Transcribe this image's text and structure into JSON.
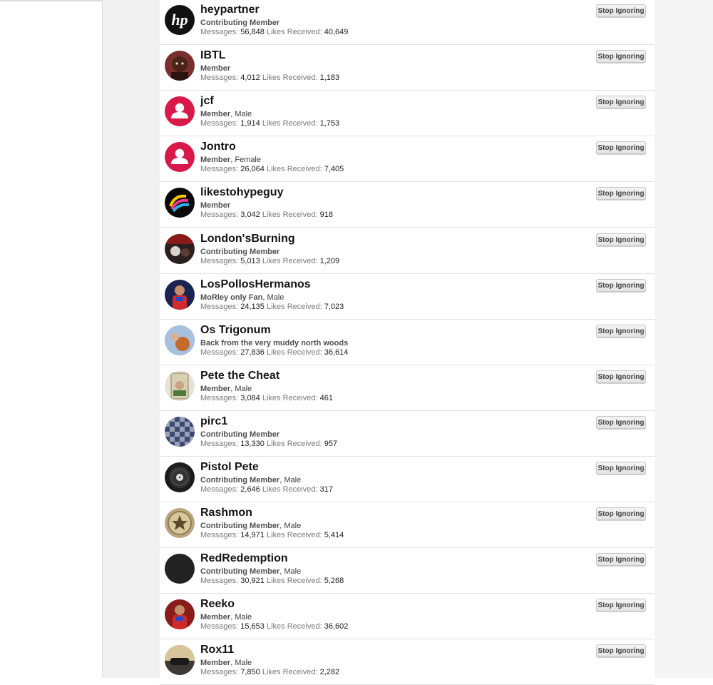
{
  "ignored_list": {
    "button_label": "Stop Ignoring",
    "messages_label": "Messages:",
    "likes_label": "Likes Received:",
    "members": [
      {
        "username": "heypartner",
        "title": "Contributing Member",
        "gender": "",
        "messages": "56,848",
        "likes": "40,649",
        "avatar_icon": "hp-logo-icon",
        "avatar_color": "#111111"
      },
      {
        "username": "IBTL",
        "title": "Member",
        "gender": "",
        "messages": "4,012",
        "likes": "1,183",
        "avatar_icon": "face-photo-icon",
        "avatar_color": "#7a2f2f"
      },
      {
        "username": "jcf",
        "title": "Member",
        "gender": "Male",
        "messages": "1,914",
        "likes": "1,753",
        "avatar_icon": "default-user-icon",
        "avatar_color": "#d8194a"
      },
      {
        "username": "Jontro",
        "title": "Member",
        "gender": "Female",
        "messages": "26,064",
        "likes": "7,405",
        "avatar_icon": "default-user-icon",
        "avatar_color": "#d8194a"
      },
      {
        "username": "likestohypeguy",
        "title": "Member",
        "gender": "",
        "messages": "3,042",
        "likes": "918",
        "avatar_icon": "rainbow-swirl-icon",
        "avatar_color": "#0a0a0a"
      },
      {
        "username": "London'sBurning",
        "title": "Contributing Member",
        "gender": "",
        "messages": "5,013",
        "likes": "1,209",
        "avatar_icon": "band-photo-icon",
        "avatar_color": "#2a2020"
      },
      {
        "username": "LosPollosHermanos",
        "title": "MoRley only Fan",
        "gender": "Male",
        "messages": "24,135",
        "likes": "7,023",
        "avatar_icon": "player-photo-icon",
        "avatar_color": "#1b2450"
      },
      {
        "username": "Os Trigonum",
        "title": "Back from the very muddy north woods",
        "gender": "",
        "messages": "27,836",
        "likes": "36,614",
        "avatar_icon": "basketball-photo-icon",
        "avatar_color": "#6f8fb8"
      },
      {
        "username": "Pete the Cheat",
        "title": "Member",
        "gender": "Male",
        "messages": "3,084",
        "likes": "461",
        "avatar_icon": "trading-card-icon",
        "avatar_color": "#e7e2d5"
      },
      {
        "username": "pirc1",
        "title": "Contributing Member",
        "gender": "",
        "messages": "13,330",
        "likes": "957",
        "avatar_icon": "chessboard-icon",
        "avatar_color": "#9aa0b8"
      },
      {
        "username": "Pistol Pete",
        "title": "Contributing Member",
        "gender": "Male",
        "messages": "2,646",
        "likes": "317",
        "avatar_icon": "vinyl-record-icon",
        "avatar_color": "#1c1c1c"
      },
      {
        "username": "Rashmon",
        "title": "Contributing Member",
        "gender": "Male",
        "messages": "14,971",
        "likes": "5,414",
        "avatar_icon": "star-badge-icon",
        "avatar_color": "#b9a57e"
      },
      {
        "username": "RedRedemption",
        "title": "Contributing Member",
        "gender": "Male",
        "messages": "30,921",
        "likes": "5,268",
        "avatar_icon": "blank-avatar-icon",
        "avatar_color": "#222222"
      },
      {
        "username": "Reeko",
        "title": "Member",
        "gender": "Male",
        "messages": "15,653",
        "likes": "36,602",
        "avatar_icon": "player-photo-icon",
        "avatar_color": "#8a1c1c"
      },
      {
        "username": "Rox11",
        "title": "Member",
        "gender": "Male",
        "messages": "7,850",
        "likes": "2,282",
        "avatar_icon": "car-photo-icon",
        "avatar_color": "#8a7a55"
      }
    ]
  }
}
